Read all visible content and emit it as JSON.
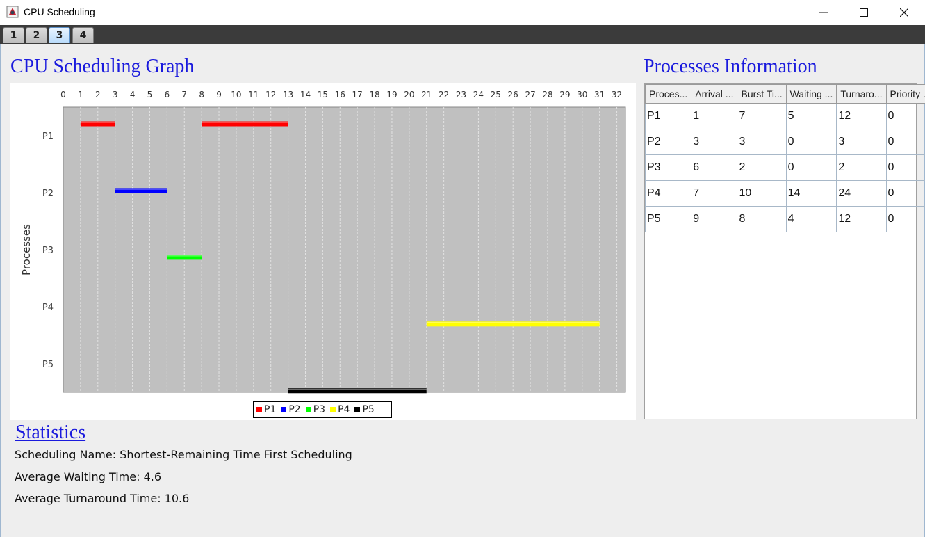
{
  "window": {
    "title": "CPU Scheduling",
    "minimize": "—",
    "maximize": "☐",
    "close": "✕"
  },
  "tabs": [
    {
      "label": "1"
    },
    {
      "label": "2"
    },
    {
      "label": "3"
    },
    {
      "label": "4"
    }
  ],
  "active_tab": "3",
  "graph": {
    "heading": "CPU Scheduling Graph"
  },
  "table": {
    "heading": "Processes Information",
    "columns": [
      "Proces...",
      "Arrival ...",
      "Burst Ti...",
      "Waiting ...",
      "Turnaro...",
      "Priority ..."
    ],
    "rows": [
      [
        "P1",
        "1",
        "7",
        "5",
        "12",
        "0"
      ],
      [
        "P2",
        "3",
        "3",
        "0",
        "3",
        "0"
      ],
      [
        "P3",
        "6",
        "2",
        "0",
        "2",
        "0"
      ],
      [
        "P4",
        "7",
        "10",
        "14",
        "24",
        "0"
      ],
      [
        "P5",
        "9",
        "8",
        "4",
        "12",
        "0"
      ]
    ]
  },
  "statistics": {
    "heading": "Statistics",
    "scheduling_name": "Scheduling Name: Shortest-Remaining Time First Scheduling",
    "avg_waiting": "Average Waiting Time: 4.6",
    "avg_turnaround": "Average Turnaround Time: 10.6"
  },
  "chart_data": {
    "type": "gantt",
    "ylabel": "Processes",
    "xlim": [
      0,
      32.5
    ],
    "x_ticks": [
      0,
      1,
      2,
      3,
      4,
      5,
      6,
      7,
      8,
      9,
      10,
      11,
      12,
      13,
      14,
      15,
      16,
      17,
      18,
      19,
      20,
      21,
      22,
      23,
      24,
      25,
      26,
      27,
      28,
      29,
      30,
      31,
      32
    ],
    "categories": [
      "P1",
      "P2",
      "P3",
      "P4",
      "P5"
    ],
    "grid": true,
    "legend_position": "bottom",
    "series": [
      {
        "name": "P1",
        "color": "#ff0000",
        "segments": [
          [
            1,
            3
          ],
          [
            8,
            13
          ]
        ]
      },
      {
        "name": "P2",
        "color": "#0000ff",
        "segments": [
          [
            3,
            6
          ]
        ]
      },
      {
        "name": "P3",
        "color": "#00ff00",
        "segments": [
          [
            6,
            8
          ]
        ]
      },
      {
        "name": "P4",
        "color": "#ffff00",
        "segments": [
          [
            21,
            31
          ]
        ]
      },
      {
        "name": "P5",
        "color": "#000000",
        "segments": [
          [
            13,
            21
          ]
        ]
      }
    ]
  }
}
